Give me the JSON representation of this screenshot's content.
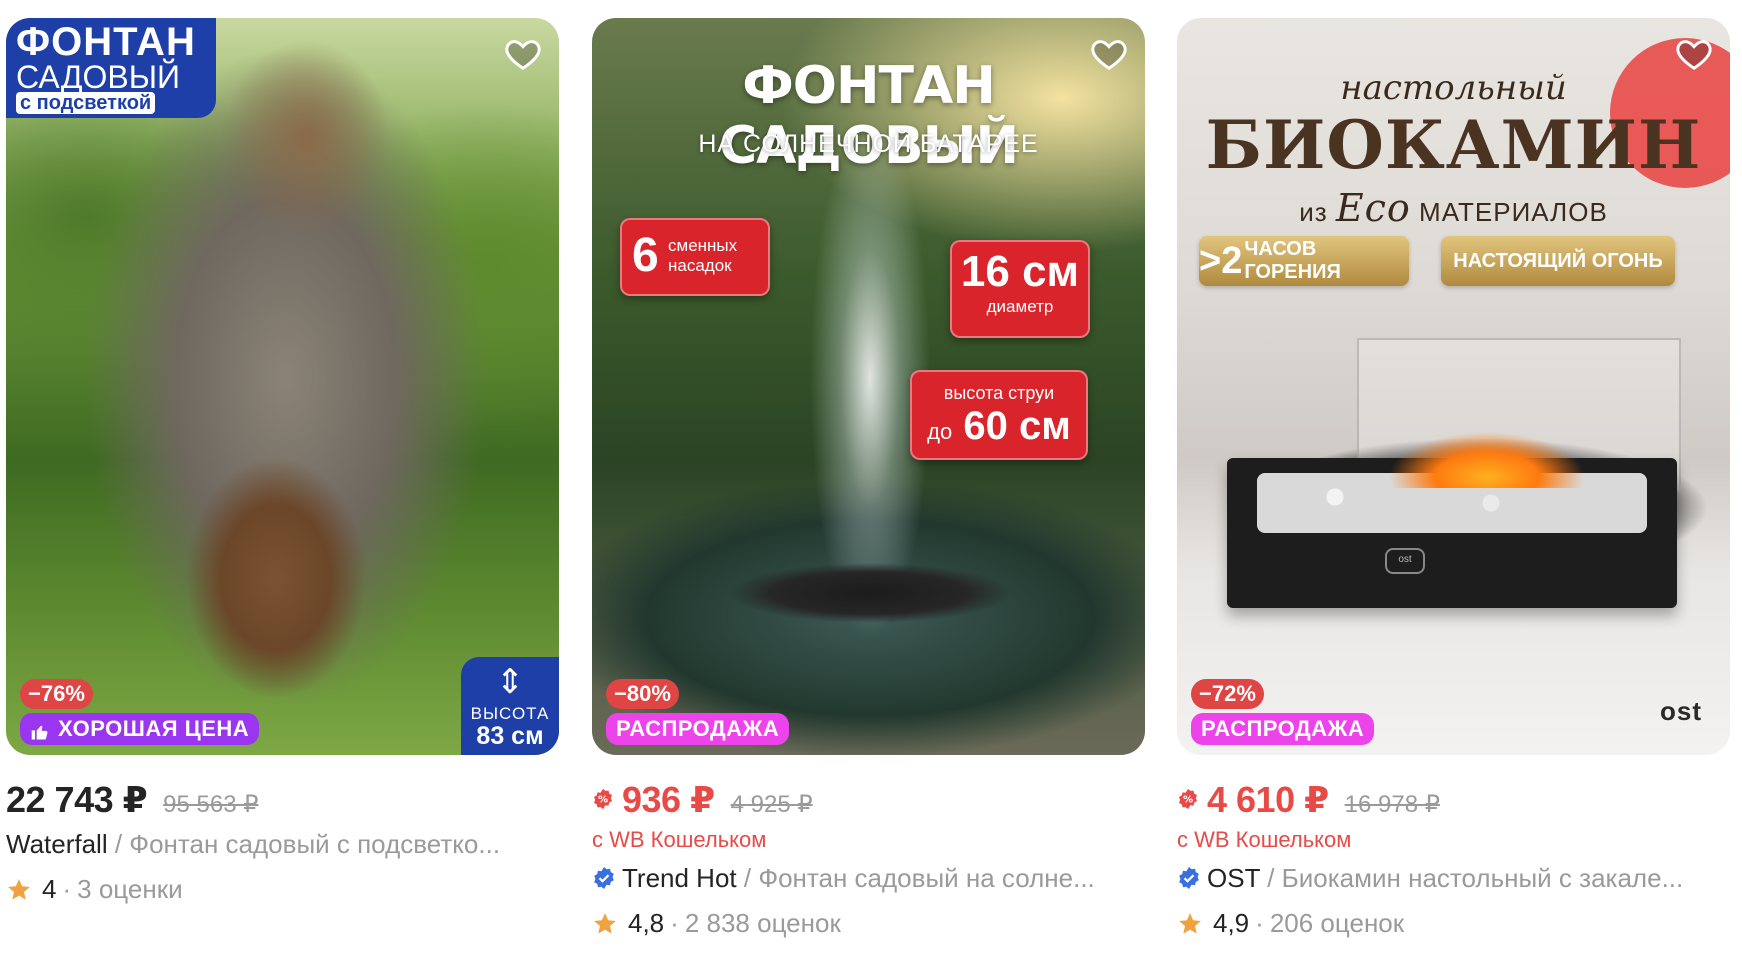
{
  "colors": {
    "price_red": "#e84a48",
    "badge_blue": "#1f3fa8",
    "tag_pink": "#ec44ea",
    "tag_purple": "#9b36f0",
    "discount_red": "#e04545",
    "star": "#f0a140",
    "verified_blue": "#3a6fe0"
  },
  "cards": [
    {
      "image": {
        "badge_line1": "ФОНТАН",
        "badge_line2": "САДОВЫЙ",
        "badge_line3": "с подсветкой",
        "height_label": "ВЫСОТА",
        "height_value": "83 см"
      },
      "discount": "−76%",
      "tag": "ХОРОШАЯ ЦЕНА",
      "tag_icon": "thumbs-up-icon",
      "price": "22 743 ₽",
      "old_price": "95 563 ₽",
      "brand": "Waterfall",
      "name": "Фонтан садовый с подсветко...",
      "rating": "4",
      "reviews": "3 оценки"
    },
    {
      "image": {
        "title": "ФОНТАН САДОВЫЙ",
        "subtitle": "НА СОЛНЕЧНОЙ БАТАРЕЕ",
        "box1_num": "6",
        "box1_text_1": "сменных",
        "box1_text_2": "насадок",
        "box2_big": "16 см",
        "box2_small": "диаметр",
        "box3_line1": "высота струи",
        "box3_pre": "до",
        "box3_big": "60 см"
      },
      "discount": "−80%",
      "tag": "РАСПРОДАЖА",
      "price": "936 ₽",
      "old_price": "4 925 ₽",
      "wallet_note": "с WB Кошельком",
      "brand": "Trend Hot",
      "name": "Фонтан садовый на солне...",
      "rating": "4,8",
      "reviews": "2 838 оценок"
    },
    {
      "image": {
        "sup": "настольный",
        "title": "БИОКАМИН",
        "sub_pre": "из",
        "sub_eco": "Eco",
        "sub_post": "МАТЕРИАЛОВ",
        "gold1_big": ">2",
        "gold1_text": "ЧАСОВ ГОРЕНИЯ",
        "gold2_text": "НАСТОЯЩИЙ ОГОНЬ",
        "logo_small": "ost",
        "logo_brand": "ost"
      },
      "discount": "−72%",
      "tag": "РАСПРОДАЖА",
      "price": "4 610 ₽",
      "old_price": "16 978 ₽",
      "wallet_note": "с WB Кошельком",
      "brand": "OST",
      "name": "Биокамин настольный с закале...",
      "rating": "4,9",
      "reviews": "206 оценок"
    }
  ]
}
